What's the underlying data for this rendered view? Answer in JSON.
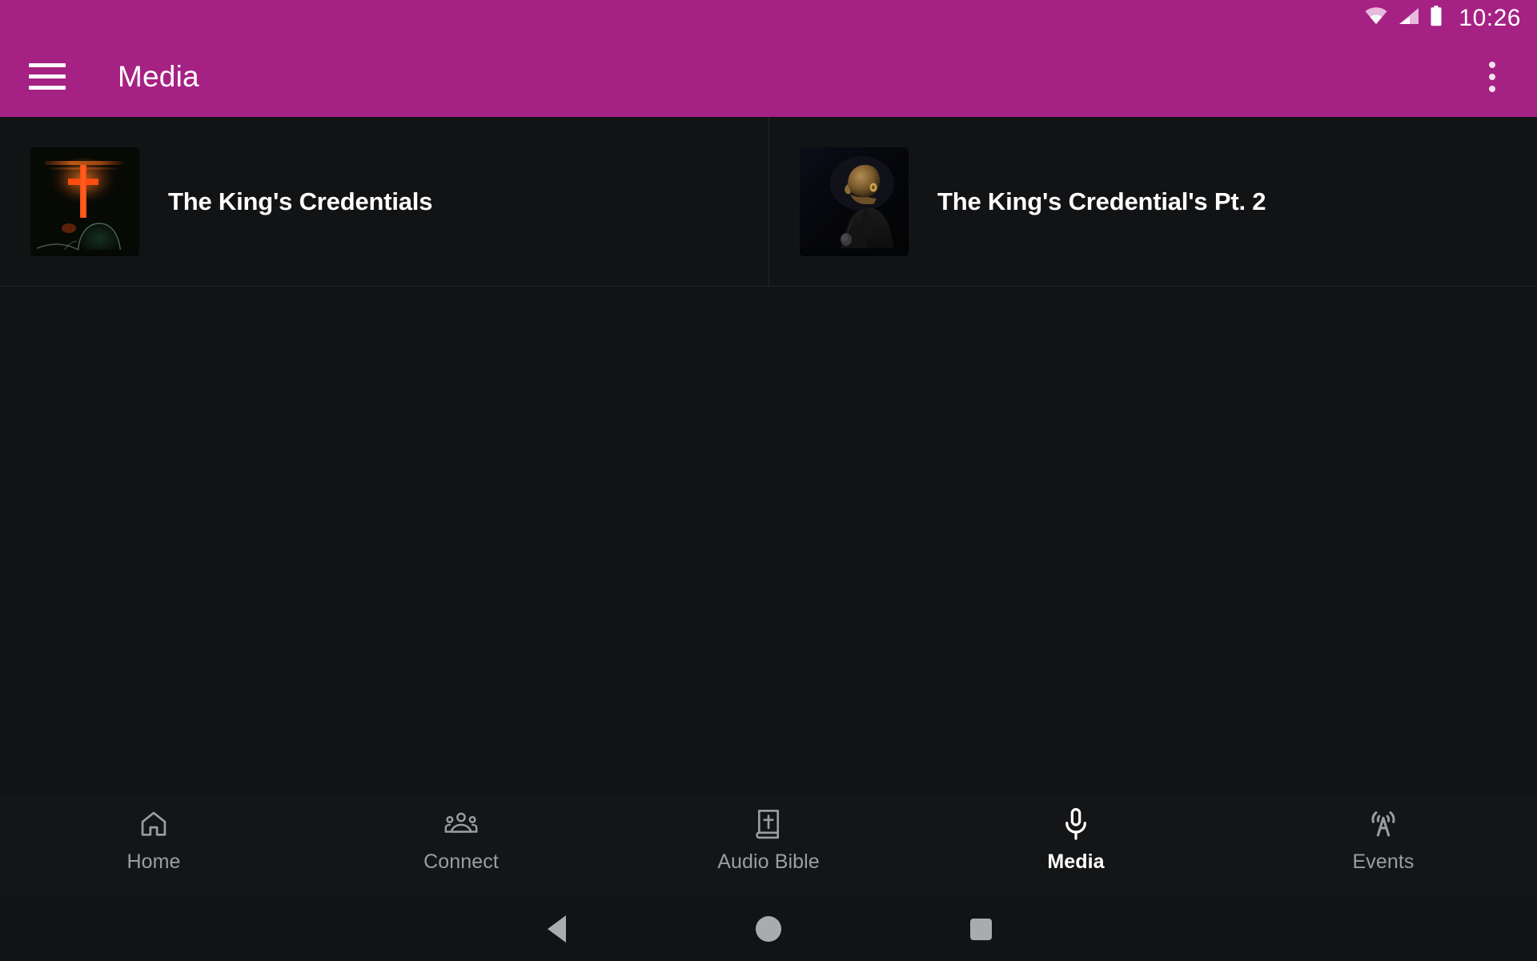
{
  "status_bar": {
    "time": "10:26",
    "icons": [
      "wifi-icon",
      "cellular-signal-icon",
      "battery-icon"
    ],
    "background_color": "#A62184"
  },
  "app_bar": {
    "menu_icon": "hamburger-menu-icon",
    "title": "Media",
    "overflow_icon": "overflow-menu-icon",
    "background_color": "#A62184",
    "text_color": "#FFFFFF"
  },
  "media_list": {
    "items": [
      {
        "title": "The King's Credentials",
        "thumbnail": "glowing-orange-cross-artwork"
      },
      {
        "title": "The King's Credential's Pt. 2",
        "thumbnail": "speaker-profile-photo"
      }
    ]
  },
  "tab_bar": {
    "active_tab": "Media",
    "active_color": "#FFFFFF",
    "inactive_color": "#9B9EA1",
    "background_color": "#141517",
    "tabs": [
      {
        "label": "Home",
        "icon": "home-icon",
        "active": false
      },
      {
        "label": "Connect",
        "icon": "people-group-icon",
        "active": false
      },
      {
        "label": "Audio Bible",
        "icon": "bible-book-icon",
        "active": false
      },
      {
        "label": "Media",
        "icon": "microphone-icon",
        "active": true
      },
      {
        "label": "Events",
        "icon": "broadcast-tower-icon",
        "active": false
      }
    ]
  },
  "system_nav": {
    "back": "back-triangle-icon",
    "home": "home-circle-icon",
    "recents": "recents-square-icon",
    "icon_color": "#A9ACAC"
  },
  "page": {
    "background_color": "#121315"
  }
}
